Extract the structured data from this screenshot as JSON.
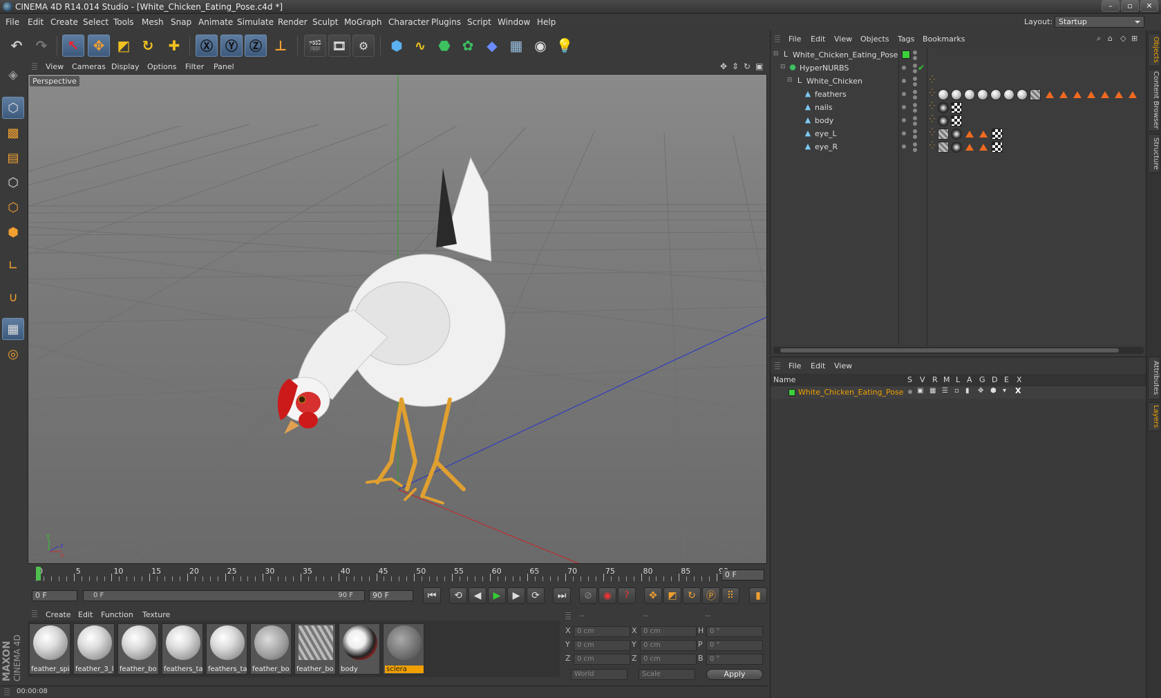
{
  "window": {
    "title": "CINEMA 4D R14.014 Studio - [White_Chicken_Eating_Pose.c4d *]",
    "min": "–",
    "max": "▫",
    "close": "✕"
  },
  "menu": [
    "File",
    "Edit",
    "Create",
    "Select",
    "Tools",
    "Mesh",
    "Snap",
    "Animate",
    "Simulate",
    "Render",
    "Sculpt",
    "MoGraph",
    "Character",
    "Plugins",
    "Script",
    "Window",
    "Help"
  ],
  "layout": {
    "label": "Layout:",
    "value": "Startup"
  },
  "viewport": {
    "menu": [
      "View",
      "Cameras",
      "Display",
      "Options",
      "Filter",
      "Panel"
    ],
    "label": "Perspective"
  },
  "timeline": {
    "ticks": [
      "0",
      "5",
      "10",
      "15",
      "20",
      "25",
      "30",
      "35",
      "40",
      "45",
      "50",
      "55",
      "60",
      "65",
      "70",
      "75",
      "80",
      "85",
      "90"
    ],
    "current_frame": "0 F"
  },
  "transport": {
    "start": "0 F",
    "range_start": "0 F",
    "range_end": "90 F",
    "end": "90 F"
  },
  "materials": {
    "menu": [
      "Create",
      "Edit",
      "Function",
      "Texture"
    ],
    "items": [
      "feather_spi",
      "feather_3_l",
      "feather_bo",
      "feathers_ta",
      "feathers_ta",
      "feather_bo",
      "feather_bo",
      "body",
      "sclera"
    ]
  },
  "coords": {
    "headers": [
      "--",
      "--",
      "--"
    ],
    "rows": [
      {
        "l1": "X",
        "v1": "0 cm",
        "l2": "X",
        "v2": "0 cm",
        "l3": "H",
        "v3": "0 °"
      },
      {
        "l1": "Y",
        "v1": "0 cm",
        "l2": "Y",
        "v2": "0 cm",
        "l3": "P",
        "v3": "0 °"
      },
      {
        "l1": "Z",
        "v1": "0 cm",
        "l2": "Z",
        "v2": "0 cm",
        "l3": "B",
        "v3": "0 °"
      }
    ],
    "world": "World",
    "scale": "Scale",
    "apply": "Apply"
  },
  "status": {
    "time": "00:00:08"
  },
  "brand": {
    "maxon": "MAXON",
    "c4d": "CINEMA 4D"
  },
  "objects": {
    "menu": [
      "File",
      "Edit",
      "View",
      "Objects",
      "Tags",
      "Bookmarks"
    ],
    "rows": [
      "White_Chicken_Eating_Pose",
      "HyperNURBS",
      "White_Chicken",
      "feathers",
      "nails",
      "body",
      "eye_L",
      "eye_R"
    ]
  },
  "layers": {
    "menu": [
      "File",
      "Edit",
      "View"
    ],
    "name_header": "Name",
    "cols": [
      "S",
      "V",
      "R",
      "M",
      "L",
      "A",
      "G",
      "D",
      "E",
      "X"
    ],
    "row": "White_Chicken_Eating_Pose",
    "row_color": "#f0a000"
  },
  "right_tabs": [
    "Objects",
    "Content Browser",
    "Structure",
    "Attributes",
    "Layers"
  ],
  "colors": {
    "accent": "#f0a000",
    "selected_tool": "#4d6b8f",
    "layer_green": "#3ad23a"
  }
}
